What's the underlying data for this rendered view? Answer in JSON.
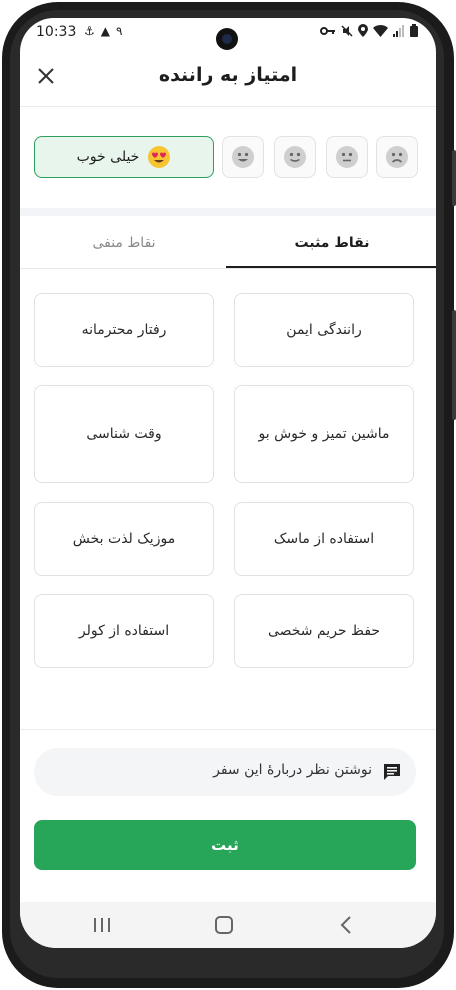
{
  "status_bar": {
    "time": "10:33",
    "left_icons": [
      "anchor-icon",
      "warning-icon",
      "notification-count-icon"
    ],
    "notification_count": "۹",
    "right_icons": [
      "key-icon",
      "mute-icon",
      "location-icon",
      "wifi-icon",
      "signal-icon",
      "battery-icon"
    ]
  },
  "header": {
    "title": "امتیاز به راننده"
  },
  "rating": {
    "selected_label": "خیلی خوب",
    "faces": [
      "very-good",
      "good",
      "ok",
      "neutral",
      "bad"
    ]
  },
  "tabs": {
    "positive": "نقاط مثبت",
    "negative": "نقاط منفی",
    "active": "positive"
  },
  "chips": [
    "رانندگی ایمن",
    "رفتار محترمانه",
    "ماشین تمیز و خوش بو",
    "وقت شناسی",
    "استفاده از ماسک",
    "موزیک لذت بخش",
    "حفظ حریم شخصی",
    "استفاده از کولر"
  ],
  "comment": {
    "placeholder": "نوشتن نظر دربارهٔ این سفر"
  },
  "submit": {
    "label": "ثبت"
  },
  "colors": {
    "accent": "#27a559",
    "selected_bg": "#e8f5ec",
    "selected_border": "#2ea05b"
  }
}
